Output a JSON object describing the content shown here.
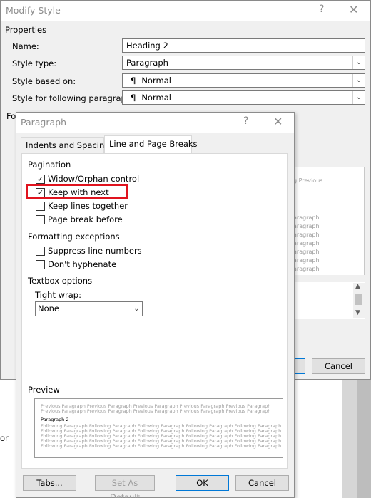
{
  "outer": {
    "title": "Modify Style",
    "help": "?",
    "close": "✕",
    "properties_heading": "Properties",
    "name_label": "Name:",
    "name_value": "Heading 2",
    "style_type_label": "Style type:",
    "style_type_value": "Paragraph",
    "based_on_label": "Style based on:",
    "based_on_value": "Normal",
    "following_label": "Style for following paragraph:",
    "following_value": "Normal",
    "formatting_partial": "For",
    "preview_ghost": [
      "g Previous",
      "aragraph",
      "aragraph",
      "aragraph",
      "aragraph",
      "aragraph",
      "aragraph",
      "aragraph",
      "aragraph",
      "aragraph"
    ],
    "cancel_label": "Cancel",
    "side_letter": "or"
  },
  "paragraph": {
    "title": "Paragraph",
    "help": "?",
    "close": "✕",
    "tabs": [
      {
        "label": "Indents and Spacing",
        "active": false
      },
      {
        "label": "Line and Page Breaks",
        "active": true
      }
    ],
    "pagination_heading": "Pagination",
    "pagination": [
      {
        "label": "Widow/Orphan control",
        "checked": true
      },
      {
        "label": "Keep with next",
        "checked": true
      },
      {
        "label": "Keep lines together",
        "checked": false
      },
      {
        "label": "Page break before",
        "checked": false
      }
    ],
    "exceptions_heading": "Formatting exceptions",
    "exceptions": [
      {
        "label": "Suppress line numbers",
        "checked": false
      },
      {
        "label": "Don't hyphenate",
        "checked": false
      }
    ],
    "textbox_heading": "Textbox options",
    "tight_wrap_label": "Tight wrap:",
    "tight_wrap_value": "None",
    "preview_heading": "Preview",
    "preview_lines": [
      "Previous Paragraph Previous Paragraph Previous Paragraph Previous Paragraph Previous Paragraph",
      "Previous Paragraph Previous Paragraph Previous Paragraph Previous Paragraph Previous Paragraph",
      "Paragraph 2",
      "Following Paragraph Following Paragraph Following Paragraph Following Paragraph Following Paragraph",
      "Following Paragraph Following Paragraph Following Paragraph Following Paragraph Following Paragraph",
      "Following Paragraph Following Paragraph Following Paragraph Following Paragraph Following Paragraph",
      "Following Paragraph Following Paragraph Following Paragraph Following Paragraph Following Paragraph",
      "Following Paragraph Following Paragraph Following Paragraph Following Paragraph Following Paragraph"
    ],
    "buttons": {
      "tabs": "Tabs...",
      "set_default": "Set As Default",
      "ok": "OK",
      "cancel": "Cancel"
    },
    "highlight_color": "#e0131e"
  }
}
